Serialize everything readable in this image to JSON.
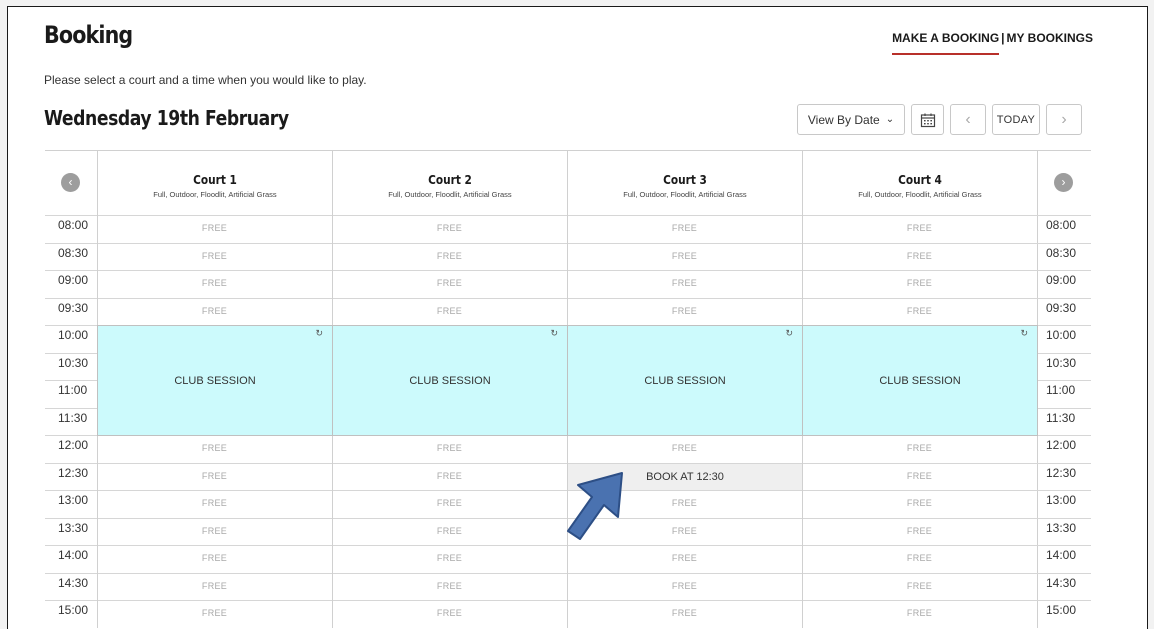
{
  "header": {
    "title": "Booking",
    "nav": {
      "make_booking": "MAKE A BOOKING",
      "separator": "|",
      "my_bookings": "MY BOOKINGS"
    },
    "subtitle": "Please select a court and a time when you would like to play.",
    "date": "Wednesday 19th February"
  },
  "controls": {
    "view_label": "View By Date",
    "view_icon": "chevron-down-icon",
    "calendar_icon": "calendar-icon",
    "prev_icon": "chevron-left-icon",
    "today_label": "TODAY",
    "next_icon": "chevron-right-icon"
  },
  "courts": [
    {
      "name": "Court 1",
      "desc": "Full, Outdoor, Floodlit, Artificial Grass"
    },
    {
      "name": "Court 2",
      "desc": "Full, Outdoor, Floodlit, Artificial Grass"
    },
    {
      "name": "Court 3",
      "desc": "Full, Outdoor, Floodlit, Artificial Grass"
    },
    {
      "name": "Court 4",
      "desc": "Full, Outdoor, Floodlit, Artificial Grass"
    }
  ],
  "times": [
    "08:00",
    "08:30",
    "09:00",
    "09:30",
    "10:00",
    "10:30",
    "11:00",
    "11:30",
    "12:00",
    "12:30",
    "13:00",
    "13:30",
    "14:00",
    "14:30",
    "15:00"
  ],
  "free_label": "FREE",
  "session": {
    "label": "CLUB SESSION",
    "icon": "repeat-icon",
    "start_time": "10:00",
    "end_time": "12:00"
  },
  "hover_book": {
    "label": "BOOK AT 12:30",
    "court": "Court 3",
    "time": "12:30"
  },
  "annotation": {
    "icon": "arrow-pointer-icon",
    "color": "#4a72b0"
  },
  "colors": {
    "session_bg": "#ccfafc",
    "accent_underline": "#b8302a",
    "free_text": "#a9a9a9"
  }
}
